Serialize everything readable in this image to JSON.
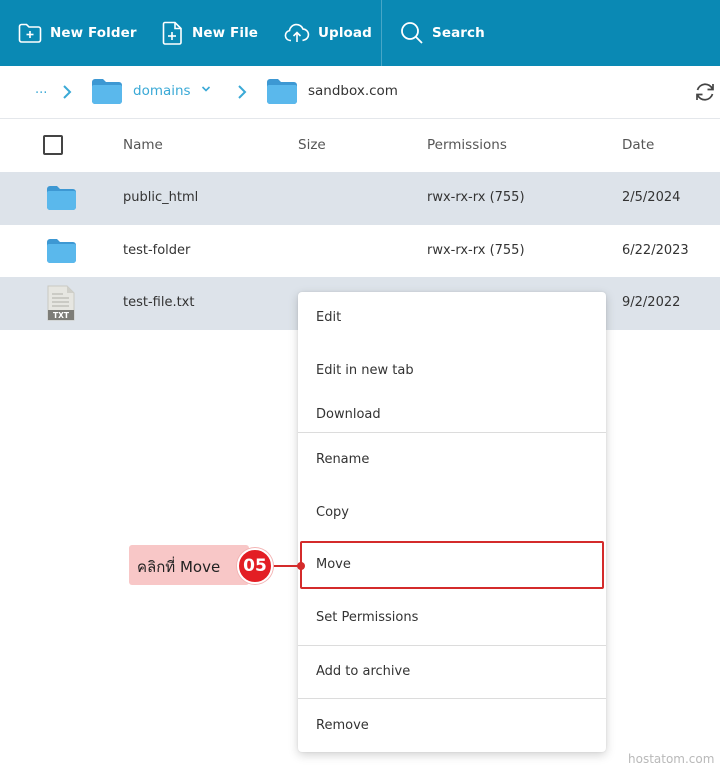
{
  "toolbar": {
    "new_folder": "New Folder",
    "new_file": "New File",
    "upload": "Upload",
    "search": "Search"
  },
  "breadcrumb": {
    "ellipsis": "...",
    "parent": "domains",
    "current": "sandbox.com"
  },
  "table": {
    "headers": {
      "name": "Name",
      "size": "Size",
      "permissions": "Permissions",
      "date": "Date"
    },
    "rows": [
      {
        "icon": "folder-icon",
        "name": "public_html",
        "permissions": "rwx-rx-rx (755)",
        "date": "2/5/2024",
        "selected": true
      },
      {
        "icon": "folder-icon",
        "name": "test-folder",
        "permissions": "rwx-rx-rx (755)",
        "date": "6/22/2023",
        "selected": false
      },
      {
        "icon": "txt-file-icon",
        "name": "test-file.txt",
        "file_badge": "TXT",
        "date": "9/2/2022",
        "selected": true
      }
    ]
  },
  "context_menu": {
    "items": [
      "Edit",
      "Edit in new tab",
      "Download",
      "Rename",
      "Copy",
      "Move",
      "Set Permissions",
      "Add to archive",
      "Remove"
    ],
    "highlighted": "Move"
  },
  "annotation": {
    "text": "คลิกที่ Move",
    "step": "05"
  },
  "watermark": "hostatom.com",
  "colors": {
    "toolbar_bg": "#0a89b4",
    "link": "#3aa9d6",
    "folder": "#5ab8ec",
    "row_alt": "#dde3ea",
    "highlight_red": "#e31e24"
  }
}
